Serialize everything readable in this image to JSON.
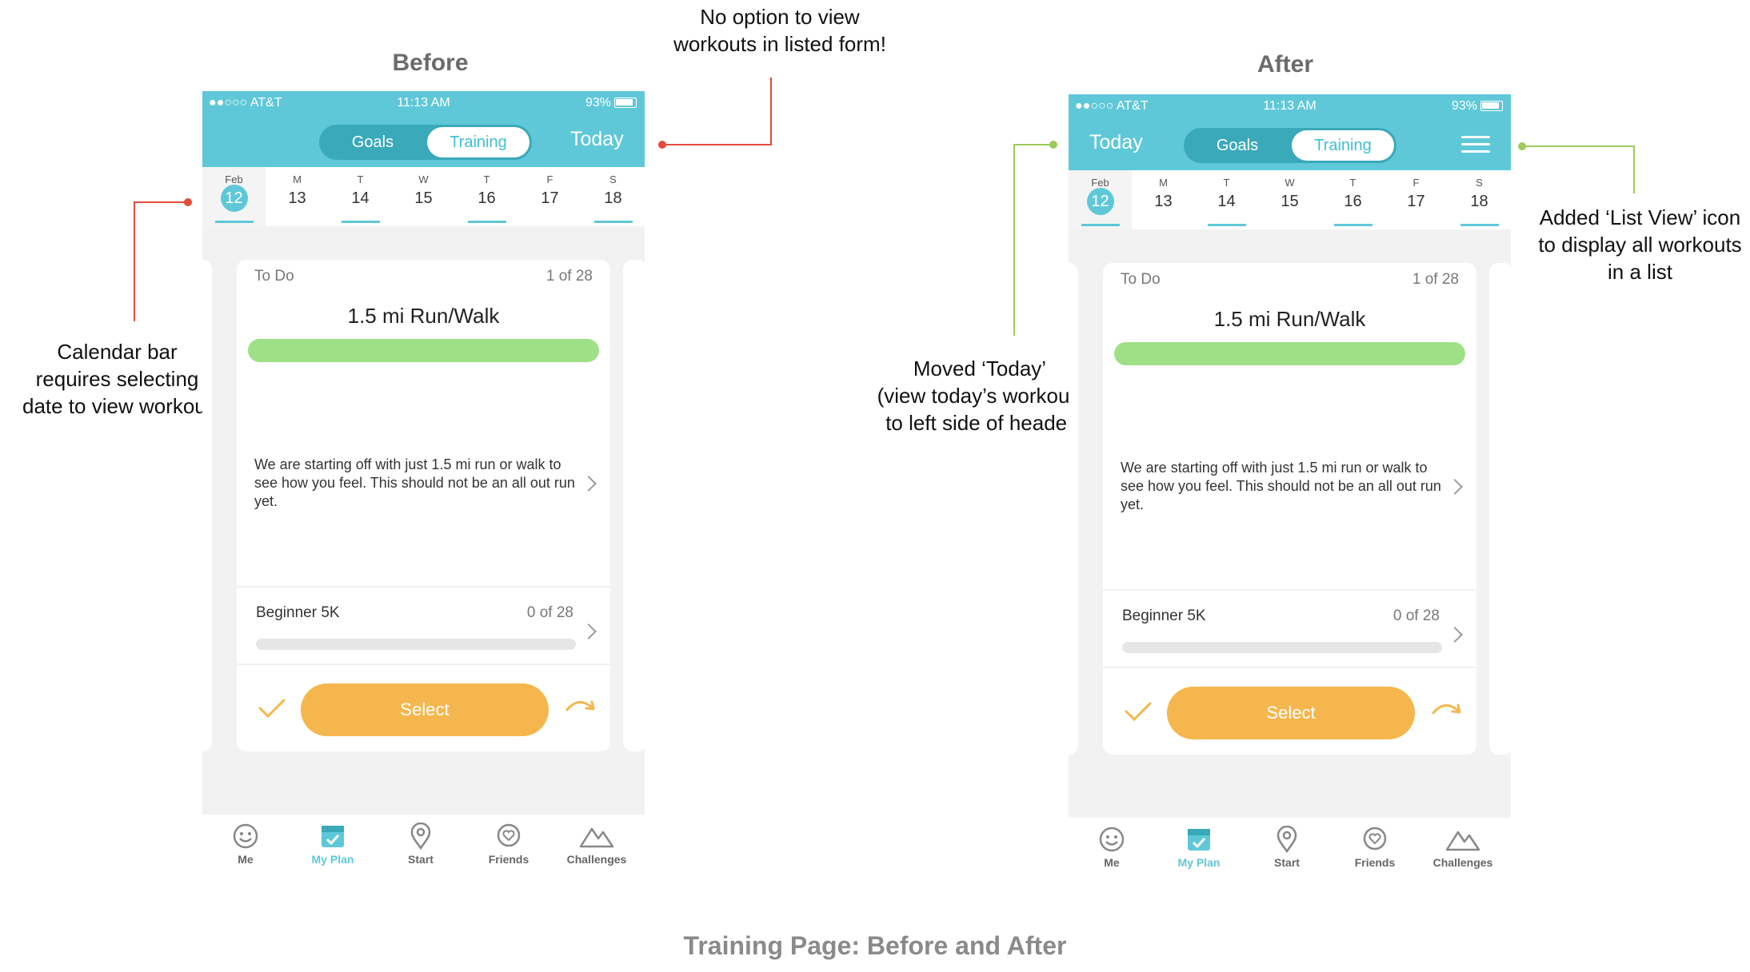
{
  "page_caption": "Training Page: Before and After",
  "before": {
    "title": "Before",
    "annotations": {
      "top": [
        "No option to view",
        "workouts in listed form!"
      ],
      "left": [
        "Calendar bar",
        "requires selecting",
        "date to view workout"
      ]
    }
  },
  "after": {
    "title": "After",
    "annotations": {
      "left": [
        "Moved ‘Today’",
        "(view today’s workout)",
        "to left side of header"
      ],
      "right": [
        "Added ‘List View’ icon",
        "to display all workouts",
        "in a list"
      ]
    }
  },
  "phone": {
    "status": {
      "carrier": "●●○○○ AT&T",
      "time": "11:13 AM",
      "battery": "93%"
    },
    "segment": {
      "goals": "Goals",
      "training": "Training"
    },
    "today_label": "Today",
    "calendar": [
      {
        "dow": "Feb",
        "num": "12"
      },
      {
        "dow": "M",
        "num": "13"
      },
      {
        "dow": "T",
        "num": "14"
      },
      {
        "dow": "W",
        "num": "15"
      },
      {
        "dow": "T",
        "num": "16"
      },
      {
        "dow": "F",
        "num": "17"
      },
      {
        "dow": "S",
        "num": "18"
      }
    ],
    "card": {
      "todo": "To Do",
      "count": "1 of 28",
      "workout": "1.5 mi Run/Walk",
      "description": "We are starting off with just 1.5 mi run or walk to see how you feel.  This should not be an all out run yet.",
      "plan_name": "Beginner 5K",
      "plan_count": "0 of 28",
      "select_label": "Select"
    },
    "tabs": [
      {
        "label": "Me",
        "icon": "smiley-icon"
      },
      {
        "label": "My Plan",
        "icon": "calendar-check-icon"
      },
      {
        "label": "Start",
        "icon": "location-pin-icon"
      },
      {
        "label": "Friends",
        "icon": "friends-heart-icon"
      },
      {
        "label": "Challenges",
        "icon": "mountains-icon"
      }
    ],
    "colors": {
      "header": "#5fc8d8",
      "progress": "#9ee085",
      "button": "#f5b74d"
    }
  }
}
